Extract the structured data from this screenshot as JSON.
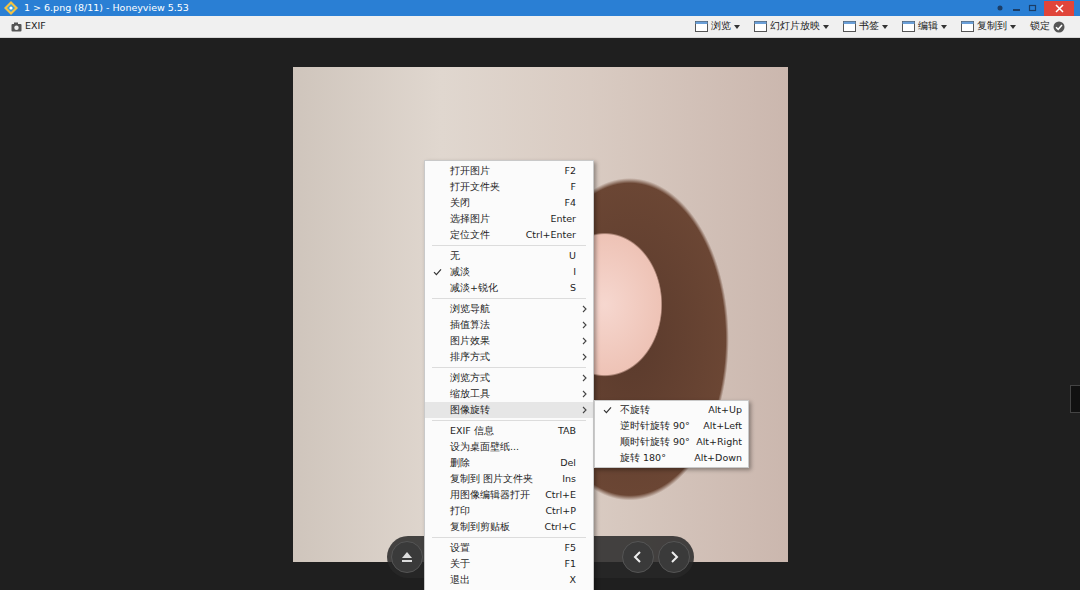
{
  "window": {
    "title": "1 > 6.png (8/11) - Honeyview 5.53"
  },
  "toolbar": {
    "left": [
      {
        "label": "EXIF"
      }
    ],
    "menus": [
      {
        "label": "浏览",
        "kind": "dropdown"
      },
      {
        "label": "幻灯片放映",
        "kind": "dropdown"
      },
      {
        "label": "书签",
        "kind": "dropdown"
      },
      {
        "label": "编辑",
        "kind": "dropdown"
      },
      {
        "label": "复制到",
        "kind": "dropdown"
      },
      {
        "label": "锁定",
        "kind": "toggle"
      }
    ]
  },
  "context_menu": {
    "groups": [
      [
        {
          "label": "打开图片",
          "shortcut": "F2",
          "checked": false,
          "submenu": false,
          "highlighted": false
        },
        {
          "label": "打开文件夹",
          "shortcut": "F",
          "checked": false,
          "submenu": false,
          "highlighted": false
        },
        {
          "label": "关闭",
          "shortcut": "F4",
          "checked": false,
          "submenu": false,
          "highlighted": false
        },
        {
          "label": "选择图片",
          "shortcut": "Enter",
          "checked": false,
          "submenu": false,
          "highlighted": false
        },
        {
          "label": "定位文件",
          "shortcut": "Ctrl+Enter",
          "checked": false,
          "submenu": false,
          "highlighted": false
        }
      ],
      [
        {
          "label": "无",
          "shortcut": "U",
          "checked": false,
          "submenu": false,
          "highlighted": false
        },
        {
          "label": "减淡",
          "shortcut": "I",
          "checked": true,
          "submenu": false,
          "highlighted": false
        },
        {
          "label": "减淡+锐化",
          "shortcut": "S",
          "checked": false,
          "submenu": false,
          "highlighted": false
        }
      ],
      [
        {
          "label": "浏览导航",
          "checked": false,
          "submenu": true,
          "highlighted": false
        },
        {
          "label": "插值算法",
          "checked": false,
          "submenu": true,
          "highlighted": false
        },
        {
          "label": "图片效果",
          "checked": false,
          "submenu": true,
          "highlighted": false
        },
        {
          "label": "排序方式",
          "checked": false,
          "submenu": true,
          "highlighted": false
        }
      ],
      [
        {
          "label": "浏览方式",
          "checked": false,
          "submenu": true,
          "highlighted": false
        },
        {
          "label": "缩放工具",
          "checked": false,
          "submenu": true,
          "highlighted": false
        },
        {
          "label": "图像旋转",
          "checked": false,
          "submenu": true,
          "highlighted": true
        }
      ],
      [
        {
          "label": "EXIF 信息",
          "shortcut": "TAB",
          "checked": false,
          "submenu": false,
          "highlighted": false
        },
        {
          "label": "设为桌面壁纸...",
          "checked": false,
          "submenu": false,
          "highlighted": false
        },
        {
          "label": "删除",
          "shortcut": "Del",
          "checked": false,
          "submenu": false,
          "highlighted": false
        },
        {
          "label": "复制到 图片文件夹",
          "shortcut": "Ins",
          "checked": false,
          "submenu": false,
          "highlighted": false
        },
        {
          "label": "用图像编辑器打开",
          "shortcut": "Ctrl+E",
          "checked": false,
          "submenu": false,
          "highlighted": false
        },
        {
          "label": "打印",
          "shortcut": "Ctrl+P",
          "checked": false,
          "submenu": false,
          "highlighted": false
        },
        {
          "label": "复制到剪贴板",
          "shortcut": "Ctrl+C",
          "checked": false,
          "submenu": false,
          "highlighted": false
        }
      ],
      [
        {
          "label": "设置",
          "shortcut": "F5",
          "checked": false,
          "submenu": false,
          "highlighted": false
        },
        {
          "label": "关于",
          "shortcut": "F1",
          "checked": false,
          "submenu": false,
          "highlighted": false
        },
        {
          "label": "退出",
          "shortcut": "X",
          "checked": false,
          "submenu": false,
          "highlighted": false
        }
      ]
    ]
  },
  "submenu": {
    "items": [
      {
        "label": "不旋转",
        "shortcut": "Alt+Up",
        "checked": true
      },
      {
        "label": "逆时针旋转 90°",
        "shortcut": "Alt+Left",
        "checked": false
      },
      {
        "label": "顺时针旋转 90°",
        "shortcut": "Alt+Right",
        "checked": false
      },
      {
        "label": "旋转 180°",
        "shortcut": "Alt+Down",
        "checked": false
      }
    ]
  }
}
